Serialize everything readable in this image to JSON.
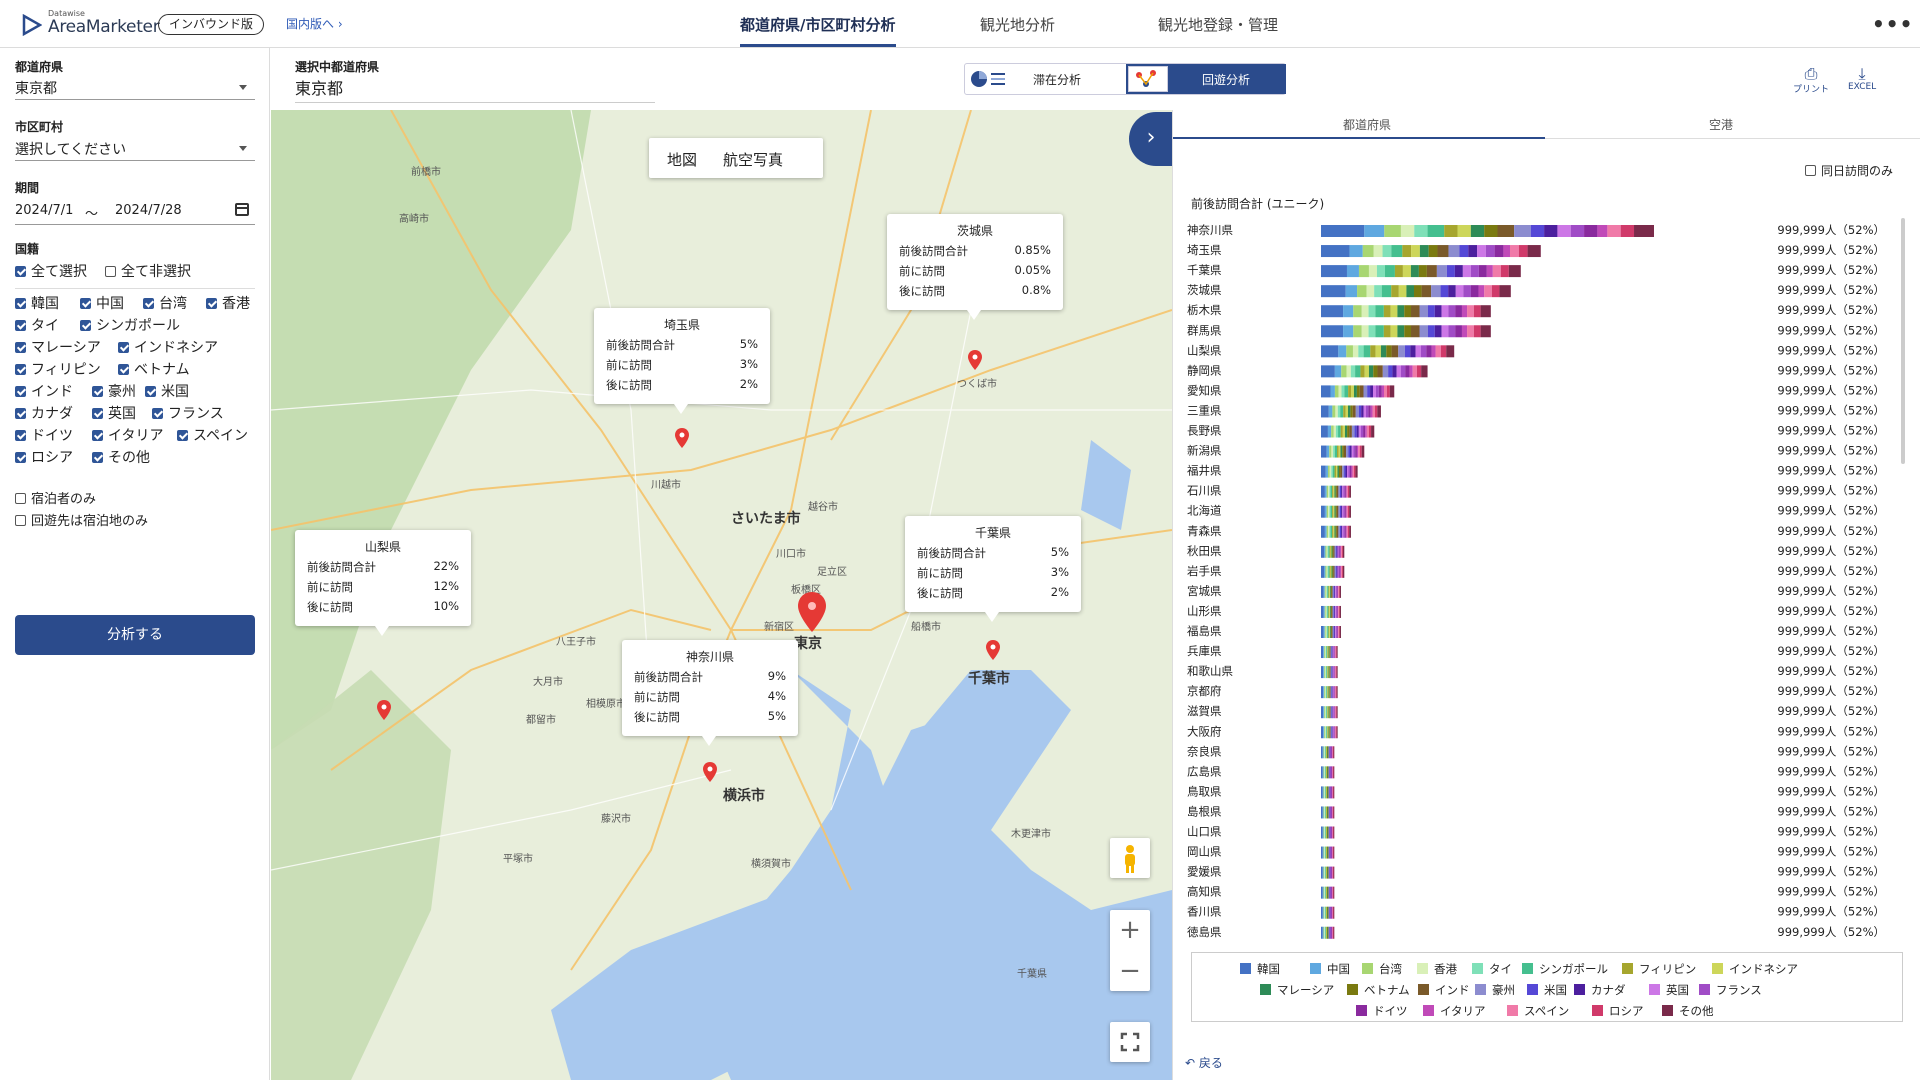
{
  "header": {
    "logo_sub": "Datawise",
    "logo_main": "AreaMarketer",
    "edition": "インバウンド版",
    "domestic_link": "国内版へ",
    "tabs": [
      "都道府県/市区町村分析",
      "観光地分析",
      "観光地登録・管理"
    ],
    "active_tab": 0
  },
  "sidebar": {
    "pref_label": "都道府県",
    "pref_value": "東京都",
    "city_label": "市区町村",
    "city_value": "選択してください",
    "period_label": "期間",
    "period_from": "2024/7/1",
    "period_sep": "〜",
    "period_to": "2024/7/28",
    "nationality_label": "国籍",
    "select_all": "全て選択",
    "deselect_all": "全て非選択",
    "nationalities": [
      {
        "label": "韓国",
        "checked": true
      },
      {
        "label": "中国",
        "checked": true
      },
      {
        "label": "台湾",
        "checked": true
      },
      {
        "label": "香港",
        "checked": true
      },
      {
        "label": "タイ",
        "checked": true
      },
      {
        "label": "シンガポール",
        "checked": true
      },
      {
        "label": "マレーシア",
        "checked": true
      },
      {
        "label": "インドネシア",
        "checked": true
      },
      {
        "label": "フィリピン",
        "checked": true
      },
      {
        "label": "ベトナム",
        "checked": true
      },
      {
        "label": "インド",
        "checked": true
      },
      {
        "label": "豪州",
        "checked": true
      },
      {
        "label": "米国",
        "checked": true
      },
      {
        "label": "カナダ",
        "checked": true
      },
      {
        "label": "英国",
        "checked": true
      },
      {
        "label": "フランス",
        "checked": true
      },
      {
        "label": "ドイツ",
        "checked": true
      },
      {
        "label": "イタリア",
        "checked": true
      },
      {
        "label": "スペイン",
        "checked": true
      },
      {
        "label": "ロシア",
        "checked": true
      },
      {
        "label": "その他",
        "checked": true
      }
    ],
    "stay_only": "宿泊者のみ",
    "dest_stay_only": "回遊先は宿泊地のみ",
    "analyze_button": "分析する"
  },
  "subheader": {
    "selected_pref_label": "選択中都道府県",
    "selected_pref_value": "東京都",
    "mode_stay": "滞在分析",
    "mode_route": "回遊分析",
    "active_mode": "回遊分析",
    "print_label": "プリント",
    "excel_label": "EXCEL"
  },
  "map": {
    "toggle_map": "地図",
    "toggle_aerial": "航空写真",
    "city_labels": [
      "さいたま市",
      "東京",
      "千葉市",
      "横浜市",
      "川越市",
      "前橋市",
      "高崎市",
      "つくば市",
      "八王子市",
      "相模原市",
      "新宿区",
      "川口市",
      "船橋市",
      "横須賀市",
      "越谷市",
      "足立区",
      "板橋区",
      "大月市",
      "都留市",
      "藤沢市",
      "平塚市",
      "木更津市",
      "千葉県"
    ],
    "popups": [
      {
        "name": "茨城県",
        "total_label": "前後訪問合計",
        "total": "0.85%",
        "before_label": "前に訪問",
        "before": "0.05%",
        "after_label": "後に訪問",
        "after": "0.8%"
      },
      {
        "name": "埼玉県",
        "total_label": "前後訪問合計",
        "total": "5%",
        "before_label": "前に訪問",
        "before": "3%",
        "after_label": "後に訪問",
        "after": "2%"
      },
      {
        "name": "山梨県",
        "total_label": "前後訪問合計",
        "total": "22%",
        "before_label": "前に訪問",
        "before": "12%",
        "after_label": "後に訪問",
        "after": "10%"
      },
      {
        "name": "千葉県",
        "total_label": "前後訪問合計",
        "total": "5%",
        "before_label": "前に訪問",
        "before": "3%",
        "after_label": "後に訪問",
        "after": "2%"
      },
      {
        "name": "神奈川県",
        "total_label": "前後訪問合計",
        "total": "9%",
        "before_label": "前に訪問",
        "before": "4%",
        "after_label": "後に訪問",
        "after": "5%"
      }
    ]
  },
  "right": {
    "tabs": [
      "都道府県",
      "空港"
    ],
    "active_tab": 0,
    "same_day_only": "同日訪問のみ",
    "chart_title": "前後訪問合計 (ユニーク)",
    "back": "戻る"
  },
  "colors": {
    "primary": "#2b4b8c",
    "pin": "#e53935",
    "nationality": [
      "#4472c4",
      "#5fa8e0",
      "#a8d672",
      "#d9f0b8",
      "#7fe0b8",
      "#45bf8f",
      "#a6a62e",
      "#cdd65a",
      "#2e8b57",
      "#7a7a10",
      "#7a5a2a",
      "#8c8ccf",
      "#5548d6",
      "#4c1f9e",
      "#cc77e6",
      "#a04cc6",
      "#8a2a9e",
      "#c04ab8",
      "#f07aa8",
      "#d03a6a",
      "#7a2a4a"
    ]
  },
  "chart_data": {
    "type": "bar",
    "stacked": true,
    "orientation": "horizontal",
    "title": "前後訪問合計 (ユニーク)",
    "categories": [
      "神奈川県",
      "埼玉県",
      "千葉県",
      "茨城県",
      "栃木県",
      "群馬県",
      "山梨県",
      "静岡県",
      "愛知県",
      "三重県",
      "長野県",
      "新潟県",
      "福井県",
      "石川県",
      "北海道",
      "青森県",
      "秋田県",
      "岩手県",
      "宮城県",
      "山形県",
      "福島県",
      "兵庫県",
      "和歌山県",
      "京都府",
      "滋賀県",
      "大阪府",
      "奈良県",
      "広島県",
      "鳥取県",
      "島根県",
      "山口県",
      "岡山県",
      "愛媛県",
      "高知県",
      "香川県",
      "徳島県"
    ],
    "totals_relative": [
      100,
      66,
      60,
      57,
      51,
      51,
      40,
      32,
      22,
      18,
      16,
      13,
      11,
      9,
      9,
      9,
      7,
      7,
      6,
      6,
      6,
      5,
      5,
      5,
      5,
      5,
      4,
      4,
      4,
      4,
      4,
      4,
      4,
      4,
      4,
      4
    ],
    "value_labels": [
      "999,999人（52%）",
      "999,999人（52%）",
      "999,999人（52%）",
      "999,999人（52%）",
      "999,999人（52%）",
      "999,999人（52%）",
      "999,999人（52%）",
      "999,999人（52%）",
      "999,999人（52%）",
      "999,999人（52%）",
      "999,999人（52%）",
      "999,999人（52%）",
      "999,999人（52%）",
      "999,999人（52%）",
      "999,999人（52%）",
      "999,999人（52%）",
      "999,999人（52%）",
      "999,999人（52%）",
      "999,999人（52%）",
      "999,999人（52%）",
      "999,999人（52%）",
      "999,999人（52%）",
      "999,999人（52%）",
      "999,999人（52%）",
      "999,999人（52%）",
      "999,999人（52%）",
      "999,999人（52%）",
      "999,999人（52%）",
      "999,999人（52%）",
      "999,999人（52%）",
      "999,999人（52%）",
      "999,999人（52%）",
      "999,999人（52%）",
      "999,999人（52%）",
      "999,999人（52%）",
      "999,999人（52%）"
    ],
    "series_shares": [
      13,
      6,
      5,
      4,
      4,
      5,
      4,
      4,
      4,
      4,
      5,
      5,
      4,
      4,
      4,
      4,
      4,
      3,
      4,
      4,
      6
    ],
    "legend": [
      "韓国",
      "中国",
      "台湾",
      "香港",
      "タイ",
      "シンガポール",
      "フィリピン",
      "インドネシア",
      "マレーシア",
      "ベトナム",
      "インド",
      "豪州",
      "米国",
      "カナダ",
      "英国",
      "フランス",
      "ドイツ",
      "イタリア",
      "スペイン",
      "ロシア",
      "その他"
    ],
    "legend_position": "bottom"
  }
}
